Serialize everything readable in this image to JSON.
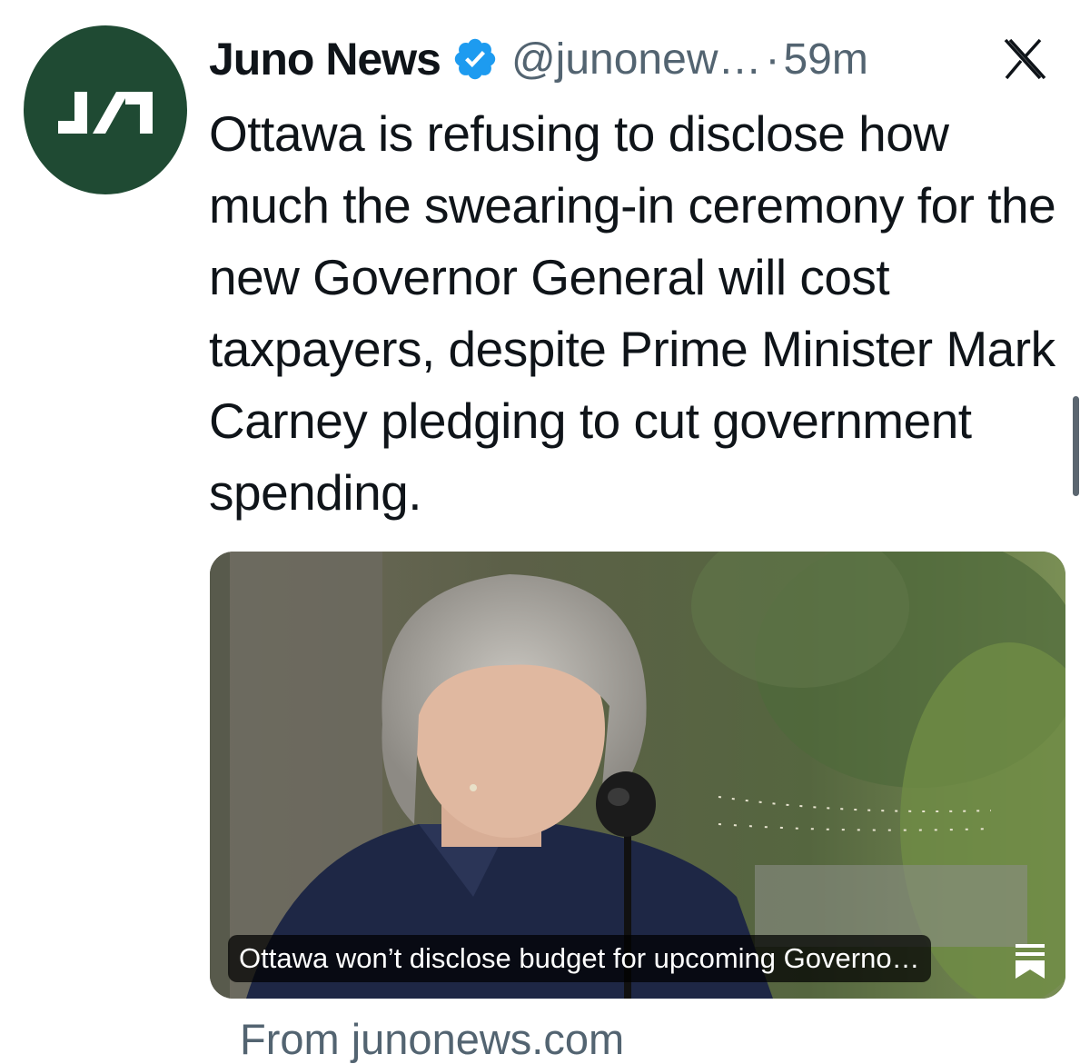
{
  "post": {
    "author_name": "Juno News",
    "handle": "@junonew…",
    "separator": "·",
    "timestamp": "59m",
    "text": "Ottawa is refusing to disclose how much the swearing-in ceremony for the new Governor General will cost taxpayers, despite Prime Minister Mark Carney pledging to cut government spending.",
    "avatar_icon": "juno-news-logo",
    "verified_icon": "verified-badge-icon",
    "platform_icon": "x-logo-icon"
  },
  "link_card": {
    "caption": "Ottawa won’t disclose budget for upcoming Governo…",
    "source": "From junonews.com",
    "bookmark_icon": "bookmark-icon"
  },
  "colors": {
    "avatar_bg": "#1f4a33",
    "verified_blue": "#1d9bf0",
    "secondary_text": "#536471"
  }
}
